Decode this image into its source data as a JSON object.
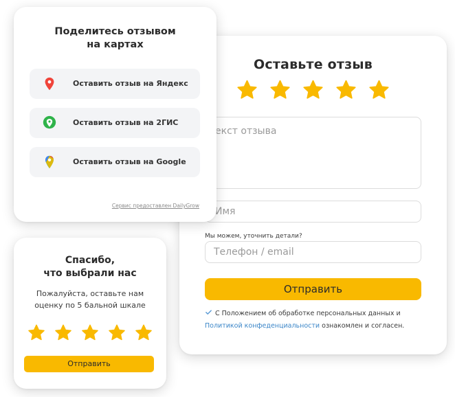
{
  "review_form": {
    "title": "Оставьте отзыв",
    "rating": 5,
    "text_placeholder": "екст отзыва",
    "name_placeholder": "Имя",
    "details_label": "Мы можем, уточнить детали?",
    "contact_placeholder": "Телефон / email",
    "submit_label": "Отправить",
    "consent": {
      "checked": true,
      "text_before": "С Положением об обработке персональных данных и",
      "link_text": "Политикой конфеденциальности",
      "text_after": "ознакомлен и согласен."
    }
  },
  "share_maps": {
    "title_line1": "Поделитесь отзывом",
    "title_line2": "на картах",
    "buttons": [
      {
        "label": "Оставить отзыв на Яндекс",
        "icon": "yandex-maps-pin-icon"
      },
      {
        "label": "Оставить отзыв на 2ГИС",
        "icon": "2gis-icon"
      },
      {
        "label": "Оставить отзыв на Google",
        "icon": "google-maps-pin-icon"
      }
    ],
    "service_note": "Сервис предоставлен DailyGrow"
  },
  "thanks": {
    "title_line1": "Спасибо,",
    "title_line2": "что выбрали нас",
    "subtitle_line1": "Пожалуйста, оставьте нам",
    "subtitle_line2": "оценку по 5 бальной шкале",
    "rating": 5,
    "submit_label": "Отправить"
  },
  "colors": {
    "accent": "#f9b900",
    "link": "#3b86c8",
    "button_bg": "#f3f4f6",
    "yandex_red": "#f0443a",
    "gis_green": "#2fb34a"
  }
}
